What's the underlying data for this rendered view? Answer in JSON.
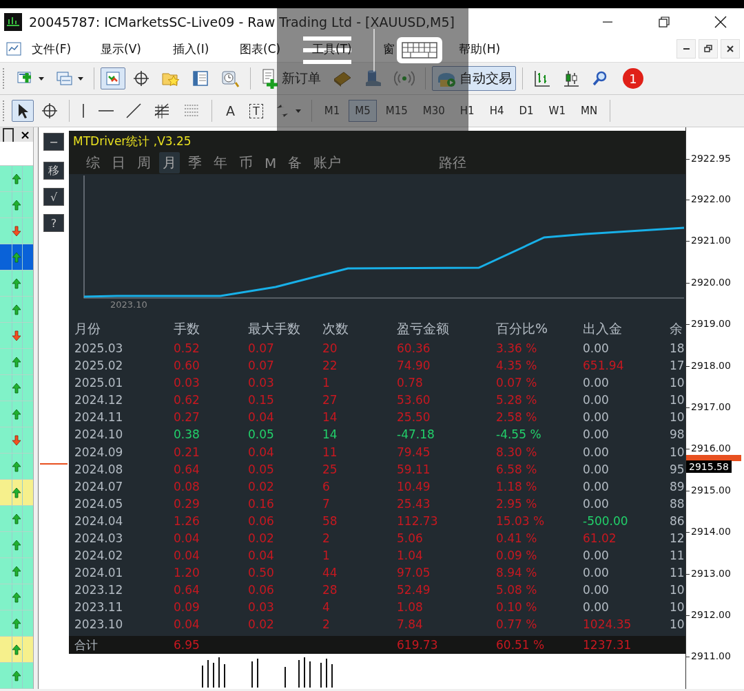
{
  "window": {
    "title": "20045787: ICMarketsSC-Live09 - Raw Trading Ltd - [XAUUSD,M5]"
  },
  "menu": {
    "items": [
      "文件(F)",
      "显示(V)",
      "插入(I)",
      "图表(C)",
      "工具(T)",
      "窗",
      "帮助(H)"
    ]
  },
  "toolbar": {
    "items": [
      {
        "kind": "icon",
        "dropdown": true,
        "selected": false
      },
      {
        "kind": "icon",
        "dropdown": true,
        "selected": false
      },
      {
        "kind": "icon",
        "dropdown": false,
        "selected": true
      },
      {
        "kind": "icon",
        "dropdown": false,
        "selected": false
      },
      {
        "kind": "icon",
        "dropdown": false,
        "selected": false
      },
      {
        "kind": "icon",
        "dropdown": false,
        "selected": false
      },
      {
        "kind": "icon",
        "dropdown": false,
        "selected": false
      },
      {
        "kind": "labeled",
        "label": "新订单",
        "selected": false
      },
      {
        "kind": "icon",
        "dropdown": false,
        "selected": false
      },
      {
        "kind": "icon",
        "dropdown": false,
        "selected": false
      },
      {
        "kind": "icon",
        "dropdown": false,
        "selected": false
      },
      {
        "kind": "labeled",
        "label": "自动交易",
        "selected": true
      },
      {
        "kind": "icon",
        "dropdown": false,
        "selected": false
      },
      {
        "kind": "icon",
        "dropdown": false,
        "selected": false
      },
      {
        "kind": "icon",
        "dropdown": false,
        "selected": false
      },
      {
        "kind": "badge",
        "label": "1"
      }
    ]
  },
  "drawing_tools": {
    "items": [
      {
        "kind": "icon",
        "selected": true,
        "dropdown": false
      },
      {
        "kind": "icon",
        "selected": false,
        "dropdown": false
      },
      {
        "kind": "icon",
        "selected": false,
        "dropdown": false
      },
      {
        "kind": "icon",
        "selected": false,
        "dropdown": false
      },
      {
        "kind": "icon",
        "selected": false,
        "dropdown": false
      },
      {
        "kind": "icon",
        "selected": false,
        "dropdown": false
      },
      {
        "kind": "icon",
        "selected": false,
        "dropdown": false
      },
      {
        "kind": "glyph",
        "label": "A",
        "selected": false
      },
      {
        "kind": "boxed",
        "label": "T",
        "selected": false
      },
      {
        "kind": "icon",
        "selected": false,
        "dropdown": true
      }
    ]
  },
  "timeframes": [
    {
      "label": "M1",
      "selected": false
    },
    {
      "label": "M5",
      "selected": true
    },
    {
      "label": "M15",
      "selected": false
    },
    {
      "label": "M30",
      "selected": false
    },
    {
      "label": "H1",
      "selected": false
    },
    {
      "label": "H4",
      "selected": false
    },
    {
      "label": "D1",
      "selected": false
    },
    {
      "label": "W1",
      "selected": false
    },
    {
      "label": "MN",
      "selected": false
    }
  ],
  "side_panel": {
    "close": "×",
    "rows": [
      {
        "kind": "up",
        "color": "#80f2c8"
      },
      {
        "kind": "up",
        "color": "#80f2c8"
      },
      {
        "kind": "down",
        "color": "#80f2c8"
      },
      {
        "kind": "up",
        "color": "#0a62d8"
      },
      {
        "kind": "up",
        "color": "#80f2c8"
      },
      {
        "kind": "up",
        "color": "#80f2c8"
      },
      {
        "kind": "down",
        "color": "#80f2c8"
      },
      {
        "kind": "up",
        "color": "#80f2c8"
      },
      {
        "kind": "up",
        "color": "#80f2c8"
      },
      {
        "kind": "up",
        "color": "#80f2c8"
      },
      {
        "kind": "down",
        "color": "#80f2c8"
      },
      {
        "kind": "up",
        "color": "#80f2c8"
      },
      {
        "kind": "up",
        "color": "#f6f08c"
      },
      {
        "kind": "up",
        "color": "#80f2c8"
      },
      {
        "kind": "up",
        "color": "#80f2c8"
      },
      {
        "kind": "up",
        "color": "#80f2c8"
      },
      {
        "kind": "up",
        "color": "#80f2c8"
      },
      {
        "kind": "up",
        "color": "#80f2c8"
      },
      {
        "kind": "up",
        "color": "#f6f08c"
      },
      {
        "kind": "up",
        "color": "#80f2c8"
      }
    ]
  },
  "chart_buttons": [
    "−",
    "移",
    "√",
    "?"
  ],
  "stats_panel": {
    "title": "MTDriver统计 ,V3.25",
    "tabs": [
      {
        "label": "综",
        "selected": false
      },
      {
        "label": "日",
        "selected": false
      },
      {
        "label": "周",
        "selected": false
      },
      {
        "label": "月",
        "selected": true
      },
      {
        "label": "季",
        "selected": false
      },
      {
        "label": "年",
        "selected": false
      },
      {
        "label": "币",
        "selected": false
      },
      {
        "label": "M",
        "selected": false
      },
      {
        "label": "备",
        "selected": false
      },
      {
        "label": "账户",
        "selected": false
      }
    ],
    "path_button": "路径",
    "equity_chart": {
      "x_label": "2023.10"
    },
    "columns": [
      "月份",
      "手数",
      "最大手数",
      "次数",
      "盈亏金额",
      "百分比%",
      "出入金",
      "余"
    ],
    "rows": [
      {
        "month": "2025.03",
        "color": "#c81820",
        "lots": "0.52",
        "max_lots": "0.07",
        "trades": "20",
        "pnl": "60.36",
        "percent": "3.36 %",
        "funds": {
          "text": "0.00",
          "color": "#b4bcc4"
        },
        "balance": "18"
      },
      {
        "month": "2025.02",
        "color": "#c81820",
        "lots": "0.60",
        "max_lots": "0.07",
        "trades": "22",
        "pnl": "74.90",
        "percent": "4.35 %",
        "funds": {
          "text": "651.94",
          "color": "#c81820"
        },
        "balance": "17"
      },
      {
        "month": "2025.01",
        "color": "#c81820",
        "lots": "0.03",
        "max_lots": "0.03",
        "trades": "1",
        "pnl": "0.78",
        "percent": "0.07 %",
        "funds": {
          "text": "0.00",
          "color": "#b4bcc4"
        },
        "balance": "10"
      },
      {
        "month": "2024.12",
        "color": "#c81820",
        "lots": "0.62",
        "max_lots": "0.15",
        "trades": "27",
        "pnl": "53.60",
        "percent": "5.28 %",
        "funds": {
          "text": "0.00",
          "color": "#b4bcc4"
        },
        "balance": "10"
      },
      {
        "month": "2024.11",
        "color": "#c81820",
        "lots": "0.27",
        "max_lots": "0.04",
        "trades": "14",
        "pnl": "25.50",
        "percent": "2.58 %",
        "funds": {
          "text": "0.00",
          "color": "#b4bcc4"
        },
        "balance": "10"
      },
      {
        "month": "2024.10",
        "color": "#22d06a",
        "lots": "0.38",
        "max_lots": "0.05",
        "trades": "14",
        "pnl": "-47.18",
        "percent": "-4.55 %",
        "funds": {
          "text": "0.00",
          "color": "#b4bcc4"
        },
        "balance": "98"
      },
      {
        "month": "2024.09",
        "color": "#c81820",
        "lots": "0.21",
        "max_lots": "0.04",
        "trades": "11",
        "pnl": "79.45",
        "percent": "8.30 %",
        "funds": {
          "text": "0.00",
          "color": "#b4bcc4"
        },
        "balance": "10"
      },
      {
        "month": "2024.08",
        "color": "#c81820",
        "lots": "0.64",
        "max_lots": "0.05",
        "trades": "25",
        "pnl": "59.11",
        "percent": "6.58 %",
        "funds": {
          "text": "0.00",
          "color": "#b4bcc4"
        },
        "balance": "95"
      },
      {
        "month": "2024.07",
        "color": "#c81820",
        "lots": "0.08",
        "max_lots": "0.02",
        "trades": "6",
        "pnl": "10.49",
        "percent": "1.18 %",
        "funds": {
          "text": "0.00",
          "color": "#b4bcc4"
        },
        "balance": "89"
      },
      {
        "month": "2024.05",
        "color": "#c81820",
        "lots": "0.29",
        "max_lots": "0.16",
        "trades": "7",
        "pnl": "25.43",
        "percent": "2.95 %",
        "funds": {
          "text": "0.00",
          "color": "#b4bcc4"
        },
        "balance": "88"
      },
      {
        "month": "2024.04",
        "color": "#c81820",
        "lots": "1.26",
        "max_lots": "0.06",
        "trades": "58",
        "pnl": "112.73",
        "percent": "15.03 %",
        "funds": {
          "text": "-500.00",
          "color": "#22d06a"
        },
        "balance": "86"
      },
      {
        "month": "2024.03",
        "color": "#c81820",
        "lots": "0.04",
        "max_lots": "0.02",
        "trades": "2",
        "pnl": "5.06",
        "percent": "0.41 %",
        "funds": {
          "text": "61.02",
          "color": "#c81820"
        },
        "balance": "12"
      },
      {
        "month": "2024.02",
        "color": "#c81820",
        "lots": "0.04",
        "max_lots": "0.04",
        "trades": "1",
        "pnl": "1.04",
        "percent": "0.09 %",
        "funds": {
          "text": "0.00",
          "color": "#b4bcc4"
        },
        "balance": "11"
      },
      {
        "month": "2024.01",
        "color": "#c81820",
        "lots": "1.20",
        "max_lots": "0.50",
        "trades": "44",
        "pnl": "97.05",
        "percent": "8.94 %",
        "funds": {
          "text": "0.00",
          "color": "#b4bcc4"
        },
        "balance": "11"
      },
      {
        "month": "2023.12",
        "color": "#c81820",
        "lots": "0.64",
        "max_lots": "0.06",
        "trades": "28",
        "pnl": "52.49",
        "percent": "5.08 %",
        "funds": {
          "text": "0.00",
          "color": "#b4bcc4"
        },
        "balance": "10"
      },
      {
        "month": "2023.11",
        "color": "#c81820",
        "lots": "0.09",
        "max_lots": "0.03",
        "trades": "4",
        "pnl": "1.08",
        "percent": "0.10 %",
        "funds": {
          "text": "0.00",
          "color": "#b4bcc4"
        },
        "balance": "10"
      },
      {
        "month": "2023.10",
        "color": "#c81820",
        "lots": "0.04",
        "max_lots": "0.02",
        "trades": "2",
        "pnl": "7.84",
        "percent": "0.77 %",
        "funds": {
          "text": "1024.35",
          "color": "#c81820"
        },
        "balance": "10"
      }
    ],
    "total": {
      "label": "合计",
      "lots": "6.95",
      "pnl": "619.73",
      "percent": "60.51 %",
      "funds": "1237.31"
    }
  },
  "price_axis": {
    "ticks": [
      "2922.95",
      "2922.00",
      "2921.00",
      "2920.00",
      "2919.00",
      "2918.00",
      "2917.00",
      "2916.00",
      "2915.00",
      "2914.00",
      "2913.00",
      "2912.00",
      "2911.00"
    ],
    "current_price": "2915.58"
  }
}
